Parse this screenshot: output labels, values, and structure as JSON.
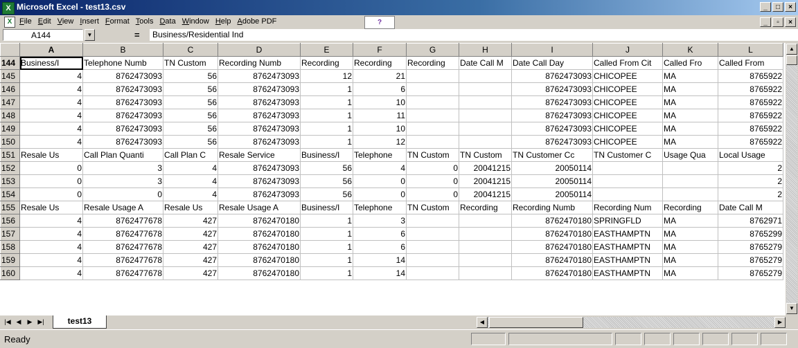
{
  "window": {
    "title": "Microsoft Excel - test13.csv"
  },
  "window_buttons": [
    "_",
    "□",
    "×"
  ],
  "menu": [
    "File",
    "Edit",
    "View",
    "Insert",
    "Format",
    "Tools",
    "Data",
    "Window",
    "Help",
    "Adobe PDF"
  ],
  "doc_buttons": [
    "_",
    "▫",
    "×"
  ],
  "formula_bar": {
    "cell_ref": "A144",
    "equals": "=",
    "content": "Business/Residential Ind"
  },
  "column_headers": [
    "A",
    "B",
    "C",
    "D",
    "E",
    "F",
    "G",
    "H",
    "I",
    "J",
    "K",
    "L"
  ],
  "rows": [
    {
      "num": "144",
      "cells": [
        "Business/I",
        "Telephone Numb",
        "TN Custom",
        "Recording Numb",
        "Recording",
        "Recording",
        "Recording",
        "Date Call M",
        "Date Call Day",
        "Called From Cit",
        "Called Fro",
        "Called From"
      ]
    },
    {
      "num": "145",
      "cells": [
        "4",
        "8762473093",
        "56",
        "8762473093",
        "12",
        "21",
        "",
        "",
        "8762473093",
        "CHICOPEE",
        "MA",
        "8765922"
      ]
    },
    {
      "num": "146",
      "cells": [
        "4",
        "8762473093",
        "56",
        "8762473093",
        "1",
        "6",
        "",
        "",
        "8762473093",
        "CHICOPEE",
        "MA",
        "8765922"
      ]
    },
    {
      "num": "147",
      "cells": [
        "4",
        "8762473093",
        "56",
        "8762473093",
        "1",
        "10",
        "",
        "",
        "8762473093",
        "CHICOPEE",
        "MA",
        "8765922"
      ]
    },
    {
      "num": "148",
      "cells": [
        "4",
        "8762473093",
        "56",
        "8762473093",
        "1",
        "11",
        "",
        "",
        "8762473093",
        "CHICOPEE",
        "MA",
        "8765922"
      ]
    },
    {
      "num": "149",
      "cells": [
        "4",
        "8762473093",
        "56",
        "8762473093",
        "1",
        "10",
        "",
        "",
        "8762473093",
        "CHICOPEE",
        "MA",
        "8765922"
      ]
    },
    {
      "num": "150",
      "cells": [
        "4",
        "8762473093",
        "56",
        "8762473093",
        "1",
        "12",
        "",
        "",
        "8762473093",
        "CHICOPEE",
        "MA",
        "8765922"
      ]
    },
    {
      "num": "151",
      "cells": [
        "Resale Us",
        "Call Plan Quanti",
        "Call Plan C",
        "Resale Service",
        "Business/I",
        "Telephone",
        "TN Custom",
        "TN Custom",
        "TN Customer Cc",
        "TN Customer C",
        "Usage Qua",
        "Local Usage"
      ]
    },
    {
      "num": "152",
      "cells": [
        "0",
        "3",
        "4",
        "8762473093",
        "56",
        "4",
        "0",
        "20041215",
        "20050114",
        "",
        "",
        "2"
      ]
    },
    {
      "num": "153",
      "cells": [
        "0",
        "3",
        "4",
        "8762473093",
        "56",
        "0",
        "0",
        "20041215",
        "20050114",
        "",
        "",
        "2"
      ]
    },
    {
      "num": "154",
      "cells": [
        "0",
        "0",
        "4",
        "8762473093",
        "56",
        "0",
        "0",
        "20041215",
        "20050114",
        "",
        "",
        "2"
      ]
    },
    {
      "num": "155",
      "cells": [
        "Resale Us",
        "Resale Usage A",
        "Resale Us",
        "Resale Usage A",
        "Business/I",
        "Telephone",
        "TN Custom",
        "Recording",
        "Recording Numb",
        "Recording Num",
        "Recording",
        "Date Call M"
      ]
    },
    {
      "num": "156",
      "cells": [
        "4",
        "8762477678",
        "427",
        "8762470180",
        "1",
        "3",
        "",
        "",
        "8762470180",
        "SPRINGFLD",
        "MA",
        "8762971"
      ]
    },
    {
      "num": "157",
      "cells": [
        "4",
        "8762477678",
        "427",
        "8762470180",
        "1",
        "6",
        "",
        "",
        "8762470180",
        "EASTHAMPTN",
        "MA",
        "8765299"
      ]
    },
    {
      "num": "158",
      "cells": [
        "4",
        "8762477678",
        "427",
        "8762470180",
        "1",
        "6",
        "",
        "",
        "8762470180",
        "EASTHAMPTN",
        "MA",
        "8765279"
      ]
    },
    {
      "num": "159",
      "cells": [
        "4",
        "8762477678",
        "427",
        "8762470180",
        "1",
        "14",
        "",
        "",
        "8762470180",
        "EASTHAMPTN",
        "MA",
        "8765279"
      ]
    },
    {
      "num": "160",
      "cells": [
        "4",
        "8762477678",
        "427",
        "8762470180",
        "1",
        "14",
        "",
        "",
        "8762470180",
        "EASTHAMPTN",
        "MA",
        "8765279"
      ]
    }
  ],
  "sheet_tab": "test13",
  "status": {
    "text": "Ready"
  }
}
